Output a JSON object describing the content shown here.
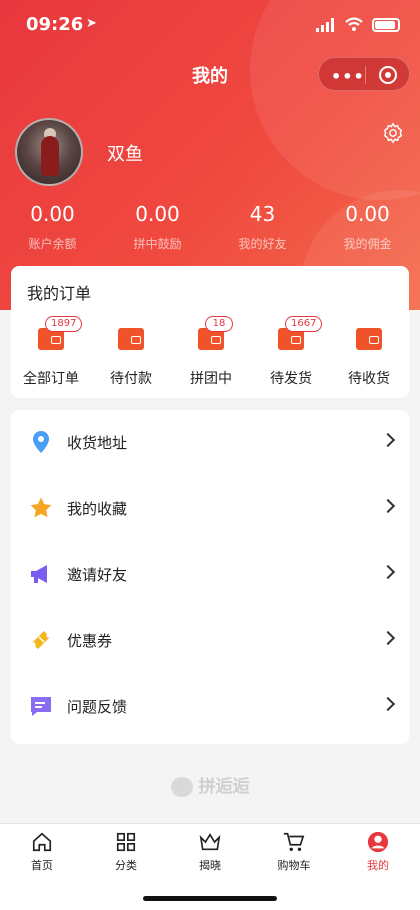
{
  "status": {
    "time": "09:26"
  },
  "nav": {
    "title": "我的"
  },
  "profile": {
    "name": "双鱼"
  },
  "stats": [
    {
      "value": "0.00",
      "label": "账户余额"
    },
    {
      "value": "0.00",
      "label": "拼中鼓励"
    },
    {
      "value": "43",
      "label": "我的好友"
    },
    {
      "value": "0.00",
      "label": "我的佣金"
    }
  ],
  "orders": {
    "title": "我的订单",
    "tabs": [
      {
        "label": "全部订单",
        "badge": "1897"
      },
      {
        "label": "待付款",
        "badge": ""
      },
      {
        "label": "拼团中",
        "badge": "18"
      },
      {
        "label": "待发货",
        "badge": "1667"
      },
      {
        "label": "待收货",
        "badge": ""
      }
    ]
  },
  "menu": [
    {
      "label": "收货地址",
      "icon": "location-pin-icon"
    },
    {
      "label": "我的收藏",
      "icon": "star-icon"
    },
    {
      "label": "邀请好友",
      "icon": "megaphone-icon"
    },
    {
      "label": "优惠券",
      "icon": "ticket-icon"
    },
    {
      "label": "问题反馈",
      "icon": "chat-bubble-icon"
    }
  ],
  "brand": {
    "text": "拼逅逅"
  },
  "tabbar": [
    {
      "label": "首页",
      "icon": "home-icon"
    },
    {
      "label": "分类",
      "icon": "grid-icon"
    },
    {
      "label": "揭晓",
      "icon": "crown-icon"
    },
    {
      "label": "购物车",
      "icon": "cart-icon"
    },
    {
      "label": "我的",
      "icon": "user-icon"
    }
  ],
  "colors": {
    "accent": "#e8383f",
    "star": "#f5a623",
    "pin": "#4a9ef5",
    "megaphone": "#7b5cf0",
    "ticket": "#f5b81c",
    "chat": "#8a6cf2"
  }
}
